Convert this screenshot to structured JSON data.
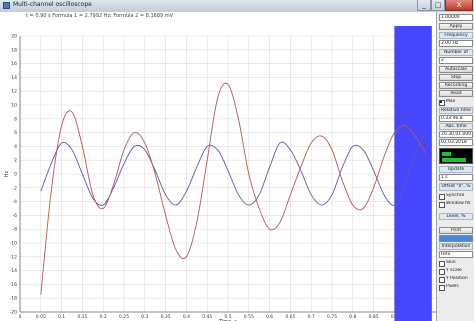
{
  "window": {
    "title": "Multi-channel oscilloscope",
    "minimize": "_",
    "maximize": "□",
    "close": "X"
  },
  "status": "t = 0.90 s  Formula 1 = 2.7992 Hz; Formula 2 = 8.1689 mV",
  "chart_data": {
    "type": "line",
    "xlabel": "Time, s",
    "ylabel": "Hz",
    "xlim": [
      0,
      1.0
    ],
    "ylim": [
      -20,
      20
    ],
    "x_ticks": [
      "0",
      "0.05",
      "0.1",
      "0.15",
      "0.2",
      "0.25",
      "0.3",
      "0.35",
      "0.4",
      "0.45",
      "0.5",
      "0.55",
      "0.6",
      "0.65",
      "0.7",
      "0.75",
      "0.8",
      "0.85",
      "0.9",
      "0.95"
    ],
    "y_ticks": [
      "-20",
      "-18",
      "-16",
      "-14",
      "-12",
      "-10",
      "-8",
      "-6",
      "-4",
      "-2",
      "0",
      "2",
      "4",
      "6",
      "8",
      "10",
      "12",
      "14",
      "16",
      "18",
      "20"
    ],
    "grid": true,
    "cursor_x": [
      0.9,
      0.99
    ],
    "colors": {
      "series1": "#5b5bb0",
      "series2": "#b05a55",
      "cursor": "#4646ff"
    },
    "series": [
      {
        "x": [
          0.05,
          0.075,
          0.1,
          0.125,
          0.15,
          0.175,
          0.2,
          0.225,
          0.25,
          0.275,
          0.3,
          0.325,
          0.35,
          0.375,
          0.4,
          0.425,
          0.45,
          0.475,
          0.5,
          0.525,
          0.55,
          0.575,
          0.6,
          0.625,
          0.65,
          0.675,
          0.7,
          0.725,
          0.75,
          0.775,
          0.8,
          0.825,
          0.85,
          0.875,
          0.9,
          0.925,
          0.95,
          0.975
        ],
        "values": [
          -2.5,
          1.5,
          4.5,
          3.5,
          0.0,
          -3.5,
          -4.5,
          -2.0,
          1.5,
          4.0,
          3.5,
          0.5,
          -3.0,
          -4.5,
          -2.5,
          1.0,
          4.0,
          3.5,
          0.5,
          -3.0,
          -4.5,
          -3.0,
          1.0,
          4.5,
          3.5,
          0.5,
          -3.0,
          -4.5,
          -3.0,
          1.0,
          4.0,
          3.5,
          0.5,
          -3.0,
          -4.5,
          -1.5,
          3.0,
          6.0
        ]
      },
      {
        "x": [
          0.05,
          0.075,
          0.1,
          0.125,
          0.15,
          0.175,
          0.2,
          0.225,
          0.25,
          0.275,
          0.3,
          0.325,
          0.35,
          0.375,
          0.4,
          0.425,
          0.45,
          0.475,
          0.5,
          0.525,
          0.55,
          0.575,
          0.6,
          0.625,
          0.65,
          0.675,
          0.7,
          0.725,
          0.75,
          0.775,
          0.8,
          0.825,
          0.85,
          0.875,
          0.9,
          0.925,
          0.95,
          0.975
        ],
        "values": [
          -17.5,
          -2.5,
          7.0,
          9.0,
          4.0,
          -3.0,
          -5.0,
          -1.5,
          3.5,
          6.0,
          4.5,
          0.0,
          -6.0,
          -11.0,
          -12.0,
          -7.0,
          2.0,
          11.0,
          13.0,
          8.0,
          0.0,
          -5.0,
          -8.0,
          -7.0,
          -3.0,
          1.0,
          4.5,
          5.5,
          3.5,
          -1.0,
          -4.5,
          -5.0,
          -2.0,
          2.5,
          6.0,
          7.0,
          5.5,
          3.0
        ]
      }
    ]
  },
  "panel": {
    "value": "1.00000",
    "apply": "Apply",
    "frequency_label": "Frequency",
    "frequency_value": "2.00 Hz",
    "number_label": "Number of",
    "number_value": "2",
    "autoscale": "Autoscale",
    "stop": "Stop",
    "recording": "Recording",
    "read": "Read",
    "max_label": "Max",
    "relative_time_label": "Relative time",
    "relative_time_value": "0.33:46.8",
    "abs_time_label": "Abs. time",
    "abs_time_value": "20.30.01.000",
    "date_value": "02.03.2018",
    "update_label": "Update",
    "update_value": "1 s",
    "offset_label": "Offset \"0\", %",
    "synchro_label": "Synchro",
    "window_label": "Window fill",
    "level_label": "Level, %",
    "print": "Print",
    "interpolation_label": "Interpolation",
    "interpolation_value": "HRS",
    "skin_label": "Skin",
    "yscale_label": "Y scale",
    "yposition_label": "Y Position",
    "pixels_label": "Pixels",
    "level_meter_top": 0.3,
    "level_meter_bottom": 0.8
  }
}
